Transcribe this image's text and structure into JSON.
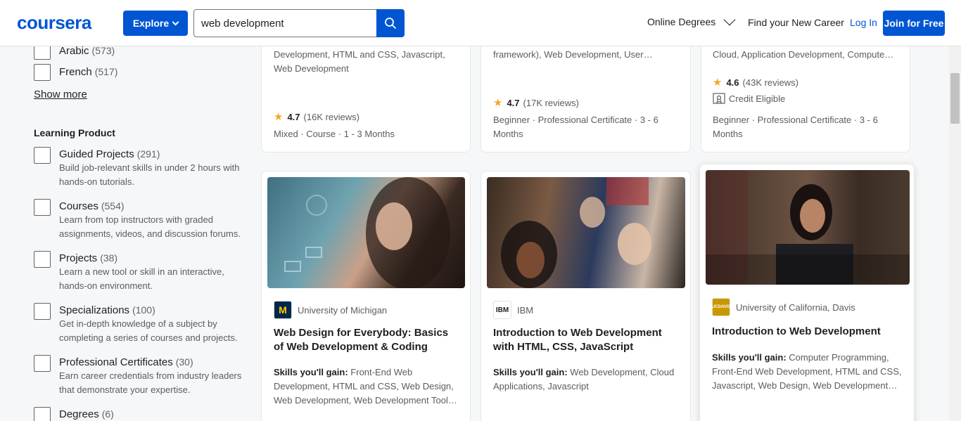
{
  "header": {
    "logo": "coursera",
    "explore_label": "Explore",
    "search_value": "web development",
    "online_degrees": "Online Degrees",
    "find_career": "Find your New Career",
    "login": "Log In",
    "join": "Join for Free"
  },
  "sidebar": {
    "languages": [
      {
        "label": "Arabic",
        "count": "(573)"
      },
      {
        "label": "French",
        "count": "(517)"
      }
    ],
    "show_more": "Show more",
    "learning_product_title": "Learning Product",
    "products": [
      {
        "label": "Guided Projects",
        "count": "(291)",
        "desc": "Build job-relevant skills in under 2 hours with hands-on tutorials."
      },
      {
        "label": "Courses",
        "count": "(554)",
        "desc": "Learn from top instructors with graded assignments, videos, and discussion forums."
      },
      {
        "label": "Projects",
        "count": "(38)",
        "desc": "Learn a new tool or skill in an interactive, hands-on environment."
      },
      {
        "label": "Specializations",
        "count": "(100)",
        "desc": "Get in-depth knowledge of a subject by completing a series of courses and projects."
      },
      {
        "label": "Professional Certificates",
        "count": "(30)",
        "desc": "Earn career credentials from industry leaders that demonstrate your expertise."
      },
      {
        "label": "Degrees",
        "count": "(6)",
        "desc": ""
      }
    ]
  },
  "top_cards": [
    {
      "skills_line1": "Development, HTML and CSS, Javascript,",
      "skills_line2": "Web Development",
      "rating": "4.7",
      "reviews": "(16K reviews)",
      "credit": "",
      "meta_line1": "Mixed · Course · 1 - 3 Months",
      "meta_line2": ""
    },
    {
      "skills_line1": "framework), Web Development, User…",
      "skills_line2": "",
      "rating": "4.7",
      "reviews": "(17K reviews)",
      "credit": "",
      "meta_line1": "Beginner · Professional Certificate · 3 - 6",
      "meta_line2": "Months"
    },
    {
      "skills_line1": "Cloud, Application Development, Compute…",
      "skills_line2": "",
      "rating": "4.6",
      "reviews": "(43K reviews)",
      "credit": "Credit Eligible",
      "meta_line1": "Beginner · Professional Certificate · 3 - 6",
      "meta_line2": "Months"
    }
  ],
  "bottom_cards": [
    {
      "partner": "University of Michigan",
      "partner_logo": "M",
      "title": "Web Design for Everybody: Basics of Web Development & Coding",
      "skills_label": "Skills you'll gain:",
      "skills": "Front-End Web Development, HTML and CSS, Web Design, Web Development, Web Development Tool…"
    },
    {
      "partner": "IBM",
      "partner_logo": "IBM",
      "title": "Introduction to Web Development with HTML, CSS, JavaScript",
      "skills_label": "Skills you'll gain:",
      "skills": "Web Development, Cloud Applications, Javascript"
    },
    {
      "partner": "University of California, Davis",
      "partner_logo": "UCDAVIS",
      "title": "Introduction to Web Development",
      "skills_label": "Skills you'll gain:",
      "skills": "Computer Programming, Front-End Web Development, HTML and CSS, Javascript, Web Design, Web Development…"
    }
  ],
  "colors": {
    "brand": "#0056d2",
    "star": "#f5a623"
  }
}
